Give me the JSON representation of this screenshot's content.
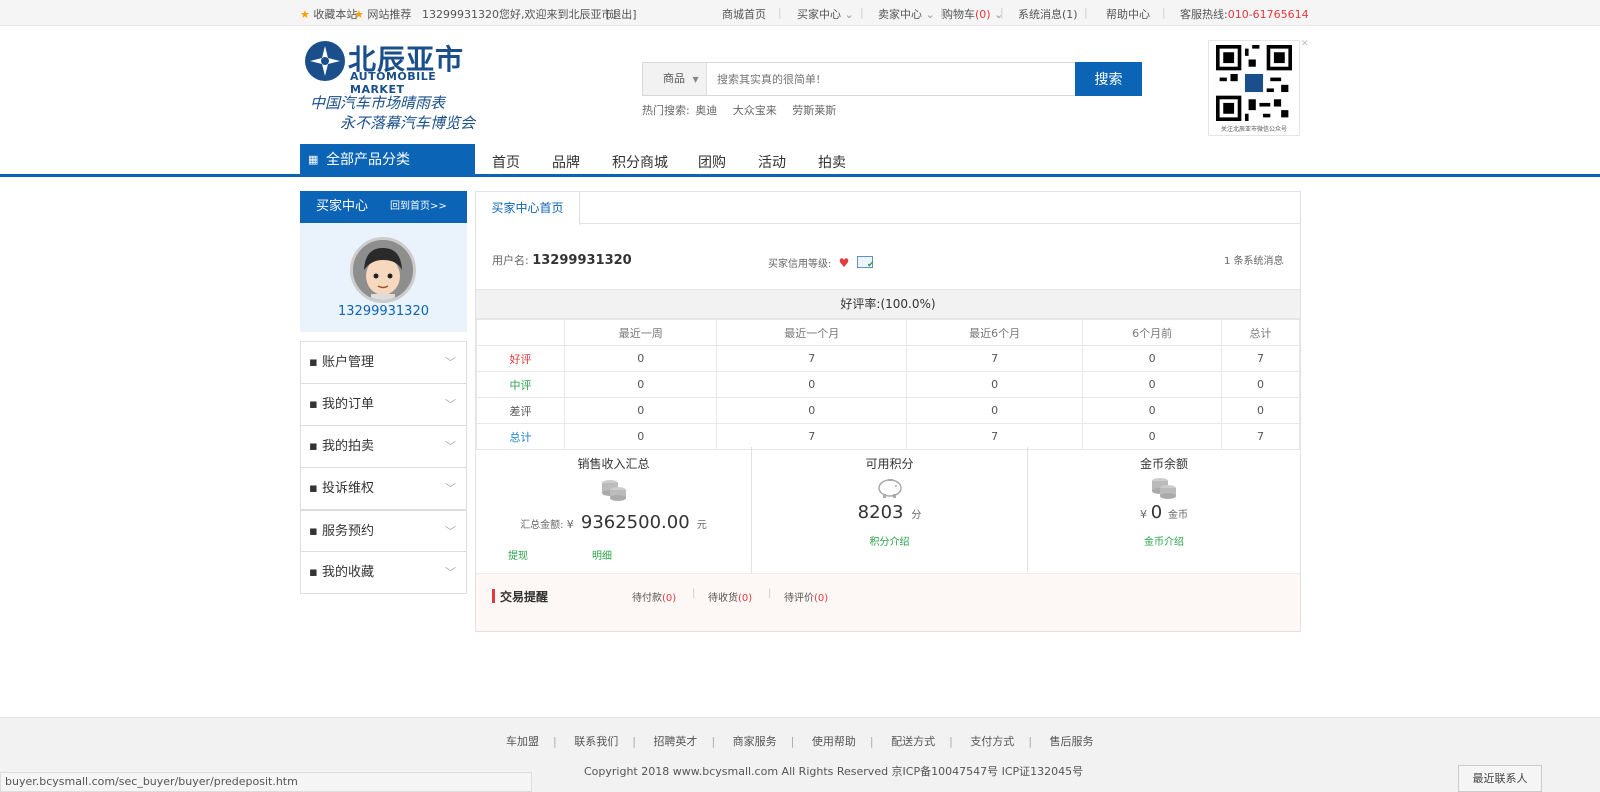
{
  "topbar": {
    "bookmark": "收藏本站",
    "recommend": "网站推荐",
    "welcome": "13299931320您好,欢迎来到北辰亚市!",
    "logout": "[退出]",
    "links": [
      "商城首页",
      "买家中心",
      "卖家中心",
      "购物车",
      "系统消息",
      "帮助中心"
    ],
    "cart_count": "(0)",
    "msg_count": "(1)",
    "hotline_label": "客服热线:",
    "hotline": "010-61765614"
  },
  "logo": {
    "name": "北辰亚市",
    "english": "AUTOMOBILE MARKET",
    "slogan1": "中国汽车市场晴雨表",
    "slogan2": "永不落幕汽车博览会"
  },
  "search": {
    "category": "商品",
    "placeholder": "搜索其实真的很简单!",
    "button": "搜索",
    "hot_label": "热门搜索:",
    "hot_terms": [
      "奥迪",
      "大众宝来",
      "劳斯莱斯"
    ]
  },
  "qr": {
    "caption": "关注北辰亚市微信公众号"
  },
  "nav": {
    "all_categories": "全部产品分类",
    "items": [
      "首页",
      "品牌",
      "积分商城",
      "团购",
      "活动",
      "拍卖"
    ]
  },
  "sidebar": {
    "title": "买家中心",
    "back": "回到首页>>",
    "username": "13299931320",
    "menu": [
      "账户管理",
      "我的订单",
      "我的拍卖",
      "投诉维权",
      "服务预约",
      "我的收藏"
    ]
  },
  "main": {
    "tab": "买家中心首页",
    "user_label": "用户名:",
    "user_value": "13299931320",
    "credit_label": "买家信用等级:",
    "sys_msg": "1 条系统消息",
    "rate_title": "好评率:(100.0%)",
    "table": {
      "headers": [
        "",
        "最近一周",
        "最近一个月",
        "最近6个月",
        "6个月前",
        "总计"
      ],
      "rows": [
        {
          "label": "好评",
          "color": "#e4393c",
          "values": [
            "0",
            "7",
            "7",
            "0",
            "7"
          ]
        },
        {
          "label": "中评",
          "color": "#2aa34a",
          "values": [
            "0",
            "0",
            "0",
            "0",
            "0"
          ]
        },
        {
          "label": "差评",
          "color": "#555555",
          "values": [
            "0",
            "0",
            "0",
            "0",
            "0"
          ]
        },
        {
          "label": "总计",
          "color": "#1a7fd0",
          "values": [
            "0",
            "7",
            "7",
            "0",
            "7"
          ]
        }
      ]
    },
    "summary": {
      "sales": {
        "title": "销售收入汇总",
        "amount_label": "汇总金额:",
        "currency": "¥",
        "amount": "9362500.00",
        "unit": "元",
        "link1": "提现",
        "link2": "明细"
      },
      "points": {
        "title": "可用积分",
        "amount": "8203",
        "unit": "分",
        "link": "积分介绍"
      },
      "gold": {
        "title": "金币余额",
        "currency": "¥",
        "amount": "0",
        "unit": "金币",
        "link": "金币介绍"
      }
    },
    "remind": {
      "title": "交易提醒",
      "items": [
        {
          "label": "待付款",
          "count": "(0)"
        },
        {
          "label": "待收货",
          "count": "(0)"
        },
        {
          "label": "待评价",
          "count": "(0)"
        }
      ]
    }
  },
  "footer": {
    "links": [
      "车加盟",
      "联系我们",
      "招聘英才",
      "商家服务",
      "使用帮助",
      "配送方式",
      "支付方式",
      "售后服务"
    ],
    "copyright": "Copyright 2018 www.bcysmall.com All Rights Reserved 京ICP备10047547号 ICP证132045号",
    "status_url": "buyer.bcysmall.com/sec_buyer/buyer/predeposit.htm",
    "recent_contacts": "最近联系人"
  }
}
